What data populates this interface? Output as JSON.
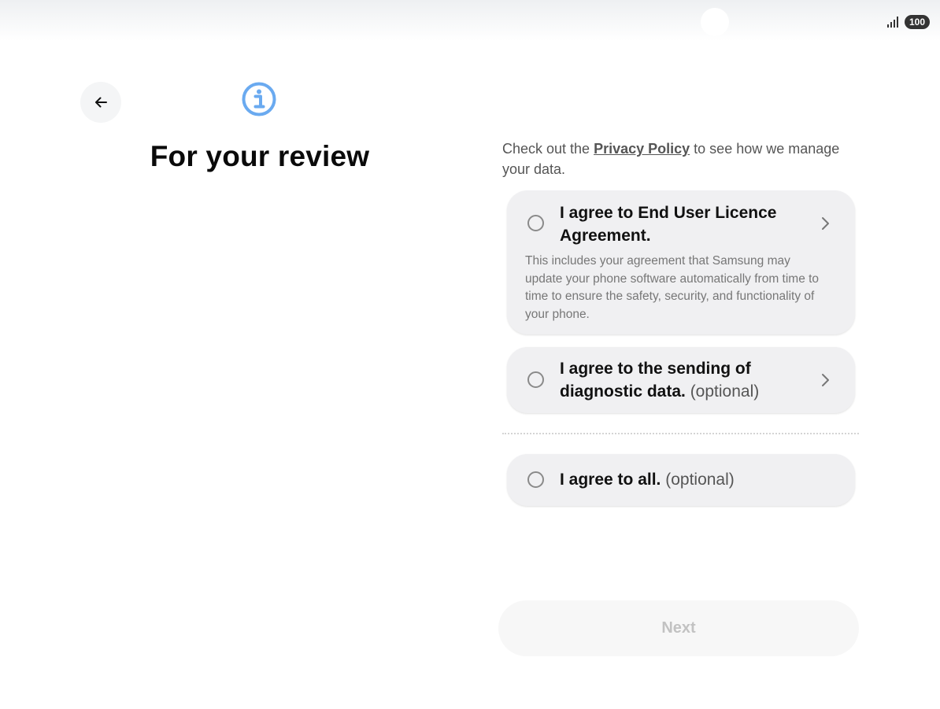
{
  "status_bar": {
    "battery_level": "100",
    "signal_icon": "signal-bars-icon"
  },
  "header": {
    "back_icon": "arrow-left-icon",
    "info_icon": "info-circle-icon",
    "title": "For your review"
  },
  "intro": {
    "text_before": "Check out the ",
    "link_text": "Privacy Policy",
    "text_after": " to see how we manage your data."
  },
  "agreements": [
    {
      "title": "I agree to End User Licence Agreement.",
      "optional_label": "",
      "description": "This includes your agreement that Samsung may update your phone software automatically from time to time to ensure the safety, security, and functionality of your phone.",
      "checked": false,
      "has_chevron": true
    },
    {
      "title": "I agree to the sending of diagnostic data.",
      "optional_label": " (optional)",
      "description": "",
      "checked": false,
      "has_chevron": true
    }
  ],
  "agree_all": {
    "title": "I agree to all.",
    "optional_label": " (optional)",
    "checked": false
  },
  "footer": {
    "next_label": "Next",
    "next_enabled": false
  },
  "colors": {
    "info_icon": "#6aaaf0",
    "card_background": "#f0f0f2",
    "next_disabled_text": "#c2c2c2"
  }
}
